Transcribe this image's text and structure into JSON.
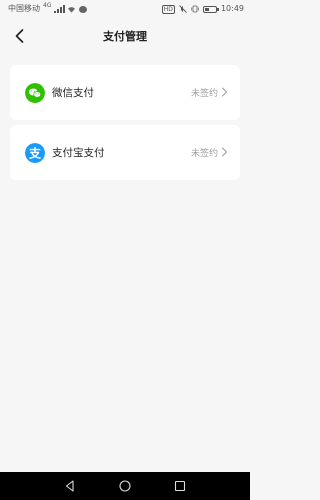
{
  "status_bar": {
    "carrier": "中国移动",
    "network": "4G",
    "hd_badge": "HD",
    "time": "10:49",
    "battery_level": 0.35
  },
  "header": {
    "title": "支付管理"
  },
  "payment_methods": [
    {
      "label": "微信支付",
      "status": "未签约",
      "icon": "wechat-icon",
      "color": "#2dc100"
    },
    {
      "label": "支付宝支付",
      "status": "未签约",
      "icon": "alipay-icon",
      "color": "#1a9bfc"
    }
  ],
  "colors": {
    "background": "#f6f6f6",
    "card": "#ffffff",
    "status_text": "#a0a0a0",
    "nav_bar": "#000000"
  }
}
